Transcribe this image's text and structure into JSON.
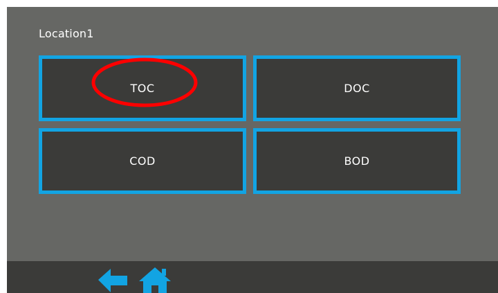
{
  "screen": {
    "location_title": "Location1"
  },
  "tiles": [
    {
      "label": "TOC"
    },
    {
      "label": "DOC"
    },
    {
      "label": "COD"
    },
    {
      "label": "BOD"
    }
  ],
  "colors": {
    "background": "#666764",
    "tile_fill": "#3b3b39",
    "tile_border": "#12a4e3",
    "highlight_circle": "#ff0000",
    "nav_icon": "#12a4e3"
  },
  "bottom_bar": {
    "icons": [
      "back-arrow-icon",
      "home-icon"
    ]
  }
}
